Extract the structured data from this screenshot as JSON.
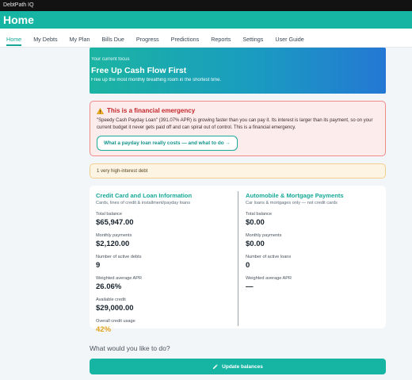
{
  "window": {
    "title": "DebtPath IQ"
  },
  "header": {
    "title": "Home"
  },
  "nav": {
    "items": [
      "Home",
      "My Debts",
      "My Plan",
      "Bills Due",
      "Progress",
      "Predictions",
      "Reports",
      "Settings",
      "User Guide"
    ],
    "active": "Home"
  },
  "hero": {
    "eyebrow": "Your current focus",
    "heading": "Free Up Cash Flow First",
    "subtitle": "Free up the most monthly breathing room in the shortest time."
  },
  "emergency": {
    "icon": "warning-icon",
    "title": "This is a financial emergency",
    "body": "\"Speedy Cash Payday Loan\" (391.07% APR) is growing faster than you can pay it. Its interest is larger than its payment, so on your current budget it never gets paid off and can spiral out of control. This is a financial emergency.",
    "button_label": "What a payday loan really costs — and what to do →"
  },
  "notice": {
    "text": "1 very high-interest debt"
  },
  "credit": {
    "title": "Credit Card and Loan Information",
    "description": "Cards, lines of credit & installment/payday loans",
    "stats": [
      {
        "label": "Total balance",
        "value": "$65,947.00"
      },
      {
        "label": "Monthly payments",
        "value": "$2,120.00"
      },
      {
        "label": "Number of active debts",
        "value": "9"
      },
      {
        "label": "Weighted average APR",
        "value": "26.06%"
      },
      {
        "label": "Available credit",
        "value": "$29,000.00"
      },
      {
        "label": "Overall credit usage",
        "value": "42%"
      }
    ]
  },
  "auto": {
    "title": "Automobile & Mortgage Payments",
    "description": "Car loans & mortgages only — not credit cards",
    "stats": [
      {
        "label": "Total balance",
        "value": "$0.00"
      },
      {
        "label": "Monthly payments",
        "value": "$0.00"
      },
      {
        "label": "Number of active loans",
        "value": "0"
      },
      {
        "label": "Weighted average APR",
        "value": "—"
      }
    ]
  },
  "actions": {
    "prompt": "What would you like to do?",
    "update_label": "Update balances",
    "update_icon": "pencil-icon"
  },
  "colors": {
    "brand": "#16b5a3",
    "emergency": "#c4282d",
    "warning_bg": "#fdf4e3",
    "usage": "#e1a21e"
  }
}
